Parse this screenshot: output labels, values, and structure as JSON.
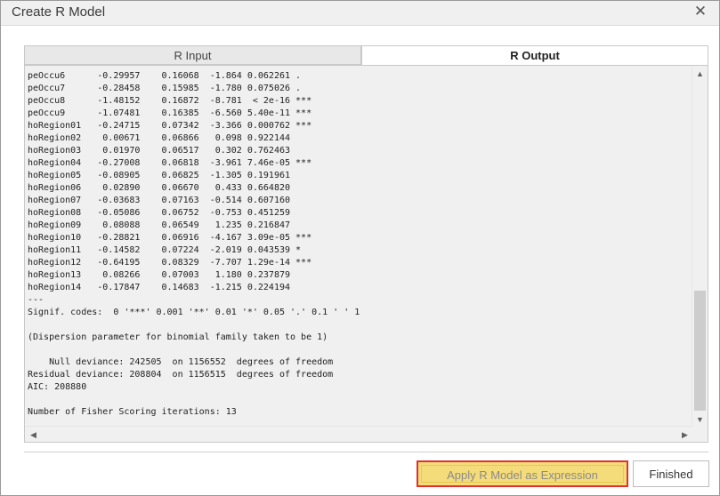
{
  "window": {
    "title": "Create R Model",
    "close_glyph": "✕"
  },
  "tabs": [
    {
      "label": "R Input",
      "active": false
    },
    {
      "label": "R Output",
      "active": true
    }
  ],
  "output": {
    "lines": [
      "peOccu6      -0.29957    0.16068  -1.864 0.062261 .",
      "peOccu7      -0.28458    0.15985  -1.780 0.075026 .",
      "peOccu8      -1.48152    0.16872  -8.781  < 2e-16 ***",
      "peOccu9      -1.07481    0.16385  -6.560 5.40e-11 ***",
      "hoRegion01   -0.24715    0.07342  -3.366 0.000762 ***",
      "hoRegion02    0.00671    0.06866   0.098 0.922144",
      "hoRegion03    0.01970    0.06517   0.302 0.762463",
      "hoRegion04   -0.27008    0.06818  -3.961 7.46e-05 ***",
      "hoRegion05   -0.08905    0.06825  -1.305 0.191961",
      "hoRegion06    0.02890    0.06670   0.433 0.664820",
      "hoRegion07   -0.03683    0.07163  -0.514 0.607160",
      "hoRegion08   -0.05086    0.06752  -0.753 0.451259",
      "hoRegion09    0.08088    0.06549   1.235 0.216847",
      "hoRegion10   -0.28821    0.06916  -4.167 3.09e-05 ***",
      "hoRegion11   -0.14582    0.07224  -2.019 0.043539 *",
      "hoRegion12   -0.64195    0.08329  -7.707 1.29e-14 ***",
      "hoRegion13    0.08266    0.07003   1.180 0.237879",
      "hoRegion14   -0.17847    0.14683  -1.215 0.224194",
      "---",
      "Signif. codes:  0 '***' 0.001 '**' 0.01 '*' 0.05 '.' 0.1 ' ' 1",
      "",
      "(Dispersion parameter for binomial family taken to be 1)",
      "",
      "    Null deviance: 242505  on 1156552  degrees of freedom",
      "Residual deviance: 208804  on 1156515  degrees of freedom",
      "AIC: 208880",
      "",
      "Number of Fisher Scoring iterations: 13"
    ]
  },
  "scrollbar": {
    "up_glyph": "▲",
    "down_glyph": "▼",
    "left_glyph": "◀",
    "right_glyph": "▶"
  },
  "buttons": {
    "apply": "Apply R Model as Expression",
    "finished": "Finished"
  },
  "colors": {
    "apply_bg": "#f4dc7a",
    "apply_border": "#e03030"
  }
}
